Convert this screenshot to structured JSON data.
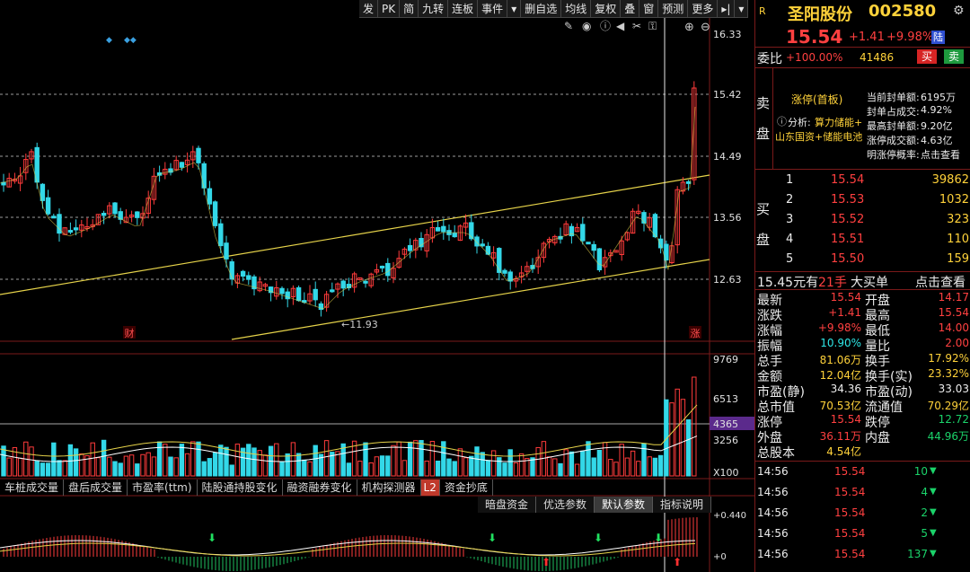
{
  "toolbar": [
    "发",
    "PK",
    "简",
    "九转",
    "连板",
    "事件",
    "▾",
    "删自选",
    "均线",
    "复权",
    "叠",
    "窗",
    "预测",
    "更多",
    "▸|",
    "▾"
  ],
  "chart_icons": [
    "pen",
    "eye",
    "info",
    "rewind",
    "scissors",
    "lock",
    "zoom-in",
    "zoom-out"
  ],
  "price_axis": [
    "16.33",
    "15.42",
    "14.49",
    "13.56",
    "12.63"
  ],
  "low_label": "11.93",
  "markers": {
    "cai": "财",
    "zhang": "涨"
  },
  "volume_axis": [
    "9769",
    "6513",
    "4365",
    "3256",
    "X100"
  ],
  "macd_axis": [
    "+0.440",
    "+0"
  ],
  "indicator_tabs": [
    "车桩成交量",
    "盘后成交量",
    "市盈率(ttm)",
    "陆股通持股变化",
    "融资融券变化",
    "机构探测器",
    "L2",
    "资金抄底"
  ],
  "param_tabs": [
    "暗盘资金",
    "优选参数",
    "默认参数",
    "指标说明"
  ],
  "stock": {
    "badge": "R",
    "name": "圣阳股份",
    "code": "002580",
    "price": "15.54",
    "change": "+1.41",
    "pct": "+9.98%",
    "tag": "陆",
    "weibi_label": "委比",
    "weibi_value": "+100.00%",
    "weibi_vol": "41486",
    "buy_btn": "买",
    "sell_btn": "卖"
  },
  "limit_info": {
    "side_label": [
      "卖",
      "盘"
    ],
    "title": "涨停(首板)",
    "analysis_label": "分析:",
    "analysis_text1": "算力储能+",
    "analysis_text2": "山东国资+储能电池",
    "stats": [
      {
        "label": "当前封单额:",
        "value": "6195万"
      },
      {
        "label": "封单占成交:",
        "value": "4.92%"
      },
      {
        "label": "最高封单额:",
        "value": "9.20亿"
      },
      {
        "label": "涨停成交额:",
        "value": "4.63亿"
      },
      {
        "label": "明涨停概率:",
        "value": "点击查看"
      }
    ]
  },
  "bid_side_label": [
    "买",
    "盘"
  ],
  "bids": [
    {
      "level": "1",
      "price": "15.54",
      "vol": "39862"
    },
    {
      "level": "2",
      "price": "15.53",
      "vol": "1032"
    },
    {
      "level": "3",
      "price": "15.52",
      "vol": "323"
    },
    {
      "level": "4",
      "price": "15.51",
      "vol": "110"
    },
    {
      "level": "5",
      "price": "15.50",
      "vol": "159"
    }
  ],
  "big_order": {
    "price": "15.45元有",
    "qty": "21手",
    "type": "大买单",
    "link": "点击查看"
  },
  "quote": [
    {
      "l1": "最新",
      "v1": "15.54",
      "c1": "red",
      "l2": "开盘",
      "v2": "14.17",
      "c2": "red"
    },
    {
      "l1": "涨跌",
      "v1": "+1.41",
      "c1": "red",
      "l2": "最高",
      "v2": "15.54",
      "c2": "red"
    },
    {
      "l1": "涨幅",
      "v1": "+9.98%",
      "c1": "red",
      "l2": "最低",
      "v2": "14.00",
      "c2": "red"
    },
    {
      "l1": "振幅",
      "v1": "10.90%",
      "c1": "cyan",
      "l2": "量比",
      "v2": "2.00",
      "c2": "red"
    },
    {
      "l1": "总手",
      "v1": "81.06万",
      "c1": "yellow",
      "l2": "换手",
      "v2": "17.92%",
      "c2": "yellow"
    },
    {
      "l1": "金额",
      "v1": "12.04亿",
      "c1": "yellow",
      "l2": "换手(实)",
      "v2": "23.32%",
      "c2": "yellow"
    },
    {
      "l1": "市盈(静)",
      "v1": "34.36",
      "c1": "white",
      "l2": "市盈(动)",
      "v2": "33.03",
      "c2": "white"
    },
    {
      "l1": "总市值",
      "v1": "70.53亿",
      "c1": "yellow",
      "l2": "流通值",
      "v2": "70.29亿",
      "c2": "yellow"
    },
    {
      "l1": "涨停",
      "v1": "15.54",
      "c1": "red",
      "l2": "跌停",
      "v2": "12.72",
      "c2": "green"
    },
    {
      "l1": "外盘",
      "v1": "36.11万",
      "c1": "red",
      "l2": "内盘",
      "v2": "44.96万",
      "c2": "green"
    },
    {
      "l1": "总股本",
      "v1": "4.54亿",
      "c1": "yellow",
      "l2": "",
      "v2": "",
      "c2": "white"
    }
  ],
  "ticks": [
    {
      "time": "14:56",
      "price": "15.54",
      "vol": "10",
      "dir": "down"
    },
    {
      "time": "14:56",
      "price": "15.54",
      "vol": "4",
      "dir": "down"
    },
    {
      "time": "14:56",
      "price": "15.54",
      "vol": "2",
      "dir": "down"
    },
    {
      "time": "14:56",
      "price": "15.54",
      "vol": "5",
      "dir": "down"
    },
    {
      "time": "14:56",
      "price": "15.54",
      "vol": "137",
      "dir": "down"
    }
  ],
  "colors": {
    "up": "#ff3b3b",
    "down": "#33d8e8",
    "ma": "#e6d34a",
    "bg": "#000000",
    "grid": "#7a1a1a"
  }
}
